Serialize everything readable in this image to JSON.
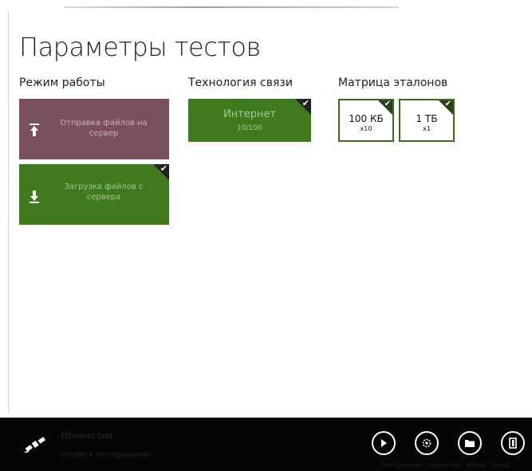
{
  "page_title": "Параметры тестов",
  "sections": {
    "mode_label": "Режим работы",
    "tech_label": "Технология связи",
    "matrix_label": "Матрица эталонов"
  },
  "mode_tiles": [
    {
      "label": "Отправка файлов на сервер",
      "selected": false,
      "color": "#7a5060"
    },
    {
      "label": "Загрузка файлов с сервера",
      "selected": true,
      "color": "#3f7a1c"
    }
  ],
  "tech_tile": {
    "label": "Интернет",
    "sub": "10/100",
    "selected": true,
    "color": "#3f7a1c"
  },
  "matrix_tiles": [
    {
      "size": "100 КБ",
      "mult": "x10",
      "selected": true
    },
    {
      "size": "1 ТБ",
      "mult": "x1",
      "selected": true
    }
  ],
  "bottom_bar": {
    "app_name": "Ethernet test",
    "status": "Готово к тестированию",
    "caption": "Тестирование · Параметры · Файлы · Выход",
    "buttons": [
      "play-icon",
      "settings-icon",
      "folder-icon",
      "exit-icon"
    ]
  },
  "check_mark": "✔"
}
